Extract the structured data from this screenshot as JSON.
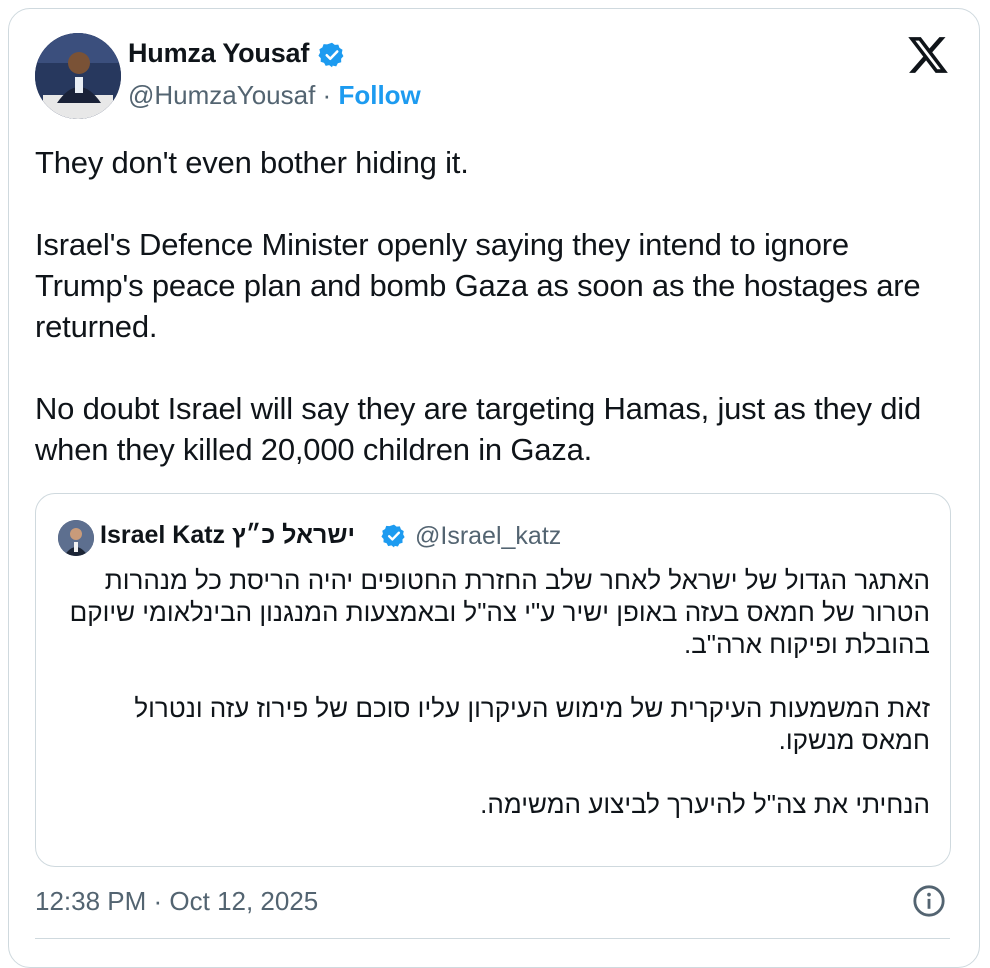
{
  "author": {
    "name": "Humza Yousaf",
    "handle": "@HumzaYousaf",
    "separator": "·",
    "follow_label": "Follow"
  },
  "tweet": {
    "text": "They don't even bother hiding it.\n\nIsrael's Defence Minister openly saying they intend to ignore Trump's peace plan and bomb Gaza as soon as the hostages are returned.\n\nNo doubt Israel will say they are targeting Hamas, just as they did when they killed 20,000 children in Gaza."
  },
  "quoted": {
    "name": "Israel Katz ישראל כ״ץ",
    "handle": "@Israel_katz",
    "text": "האתגר הגדול של ישראל לאחר שלב החזרת החטופים יהיה הריסת כל מנהרות הטרור של חמאס בעזה באופן ישיר ע\"י צה\"ל ובאמצעות המנגנון הבינלאומי שיוקם בהובלת ופיקוח ארה\"ב.\n\nזאת המשמעות העיקרית של מימוש העיקרון עליו סוכם של פירוז עזה ונטרול חמאס מנשקו.\n\nהנחיתי את צה\"ל להיערך לביצוע המשימה."
  },
  "meta": {
    "timestamp": "12:38 PM · Oct 12, 2025"
  },
  "icons": {
    "verified": "verified-badge-icon",
    "logo": "x-logo-icon",
    "info": "info-icon"
  },
  "colors": {
    "accent": "#1d9bf0",
    "muted": "#536471",
    "border": "#cfd9de"
  }
}
